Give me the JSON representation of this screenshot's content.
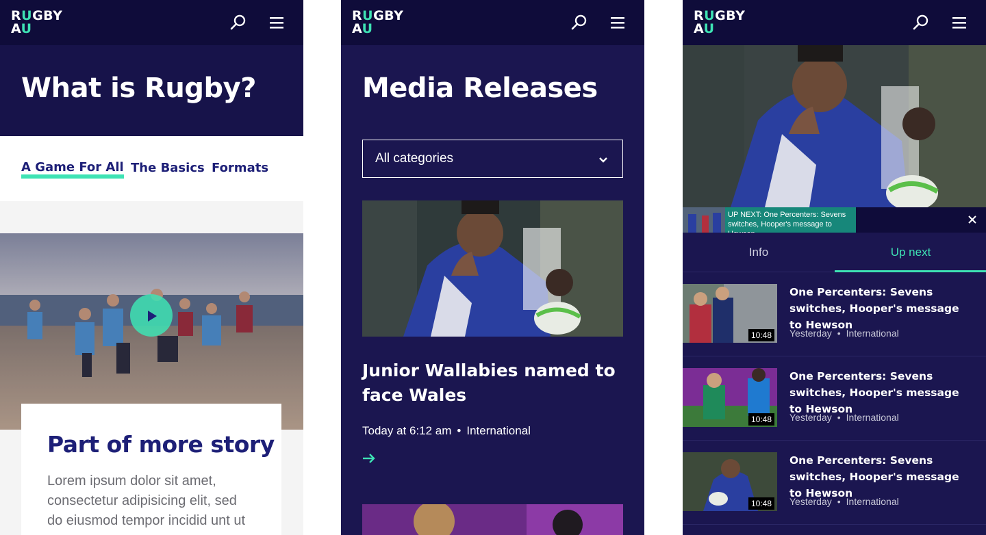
{
  "brand": {
    "logo_line1_a": "R",
    "logo_line1_b": "U",
    "logo_line1_c": "GBY",
    "logo_line2_a": "A",
    "logo_line2_b": "U"
  },
  "colors": {
    "navy": "#0f0c3a",
    "indigo": "#1b1650",
    "accent": "#3ee3b4",
    "link": "#1d1f77"
  },
  "screen1": {
    "title": "What is Rugby?",
    "tabs": [
      {
        "label": "A Game For All",
        "active": true
      },
      {
        "label": "The Basics",
        "active": false
      },
      {
        "label": "Formats",
        "active": false
      }
    ],
    "card": {
      "title": "Part of more story",
      "body": "Lorem ipsum dolor sit amet, consectetur adipisicing elit, sed do eiusmod tempor incidid unt ut"
    }
  },
  "screen2": {
    "title": "Media Releases",
    "filter": {
      "selected": "All categories"
    },
    "article": {
      "headline": "Junior Wallabies named to face Wales",
      "time": "Today at 6:12 am",
      "category": "International"
    }
  },
  "screen3": {
    "up_next_banner": "UP NEXT: One Percenters: Sevens switches, Hooper's message to Hewson",
    "tabs": [
      {
        "label": "Info",
        "active": false
      },
      {
        "label": "Up next",
        "active": true
      }
    ],
    "videos": [
      {
        "title": "One Percenters: Sevens switches, Hooper's message to Hewson",
        "duration": "10:48",
        "date": "Yesterday",
        "category": "International"
      },
      {
        "title": "One Percenters: Sevens switches, Hooper's message to Hewson",
        "duration": "10:48",
        "date": "Yesterday",
        "category": "International"
      },
      {
        "title": "One Percenters: Sevens switches, Hooper's message to Hewson",
        "duration": "10:48",
        "date": "Yesterday",
        "category": "International"
      }
    ]
  },
  "icons": {
    "search": "search-icon",
    "menu": "hamburger-menu-icon",
    "chevron": "chevron-down-icon",
    "arrow": "arrow-right-icon",
    "close": "close-icon",
    "play": "play-icon"
  }
}
